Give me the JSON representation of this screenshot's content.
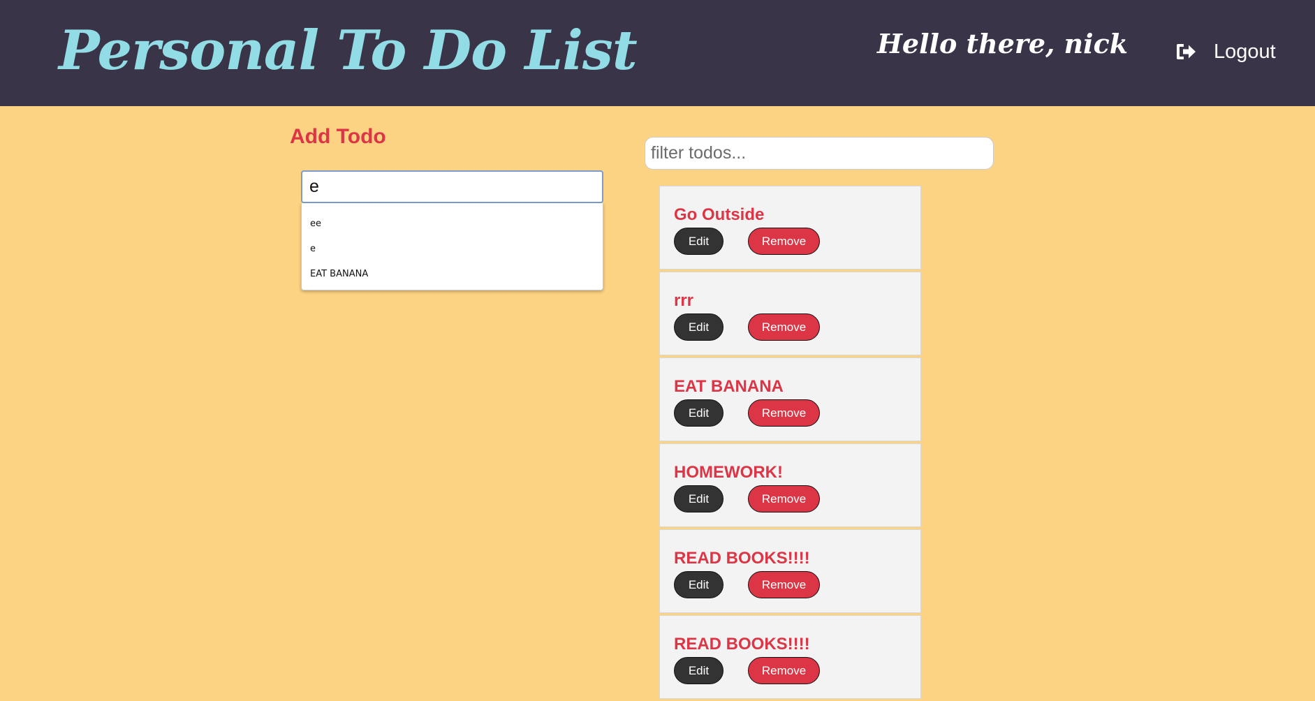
{
  "header": {
    "brand": "Personal To Do List",
    "greeting": "Hello there, nick",
    "logout_label": "Logout",
    "logout_icon": "sign-out-icon",
    "background": "#393447",
    "brand_color": "#92dce5"
  },
  "add_todo": {
    "title": "Add Todo",
    "input_value": "e",
    "suggestions": [
      "ee",
      "e",
      "EAT BANANA"
    ]
  },
  "filter": {
    "placeholder": "filter todos..."
  },
  "todos": {
    "edit_label": "Edit",
    "remove_label": "Remove",
    "items": [
      {
        "title": "Go Outside"
      },
      {
        "title": "rrr"
      },
      {
        "title": "EAT BANANA"
      },
      {
        "title": "HOMEWORK!"
      },
      {
        "title": "READ BOOKS!!!!"
      },
      {
        "title": "READ BOOKS!!!!"
      }
    ]
  },
  "colors": {
    "page_background": "#fcd283",
    "accent": "#dc3545",
    "edit_button": "#333333",
    "card_background": "#f3f3f3"
  }
}
